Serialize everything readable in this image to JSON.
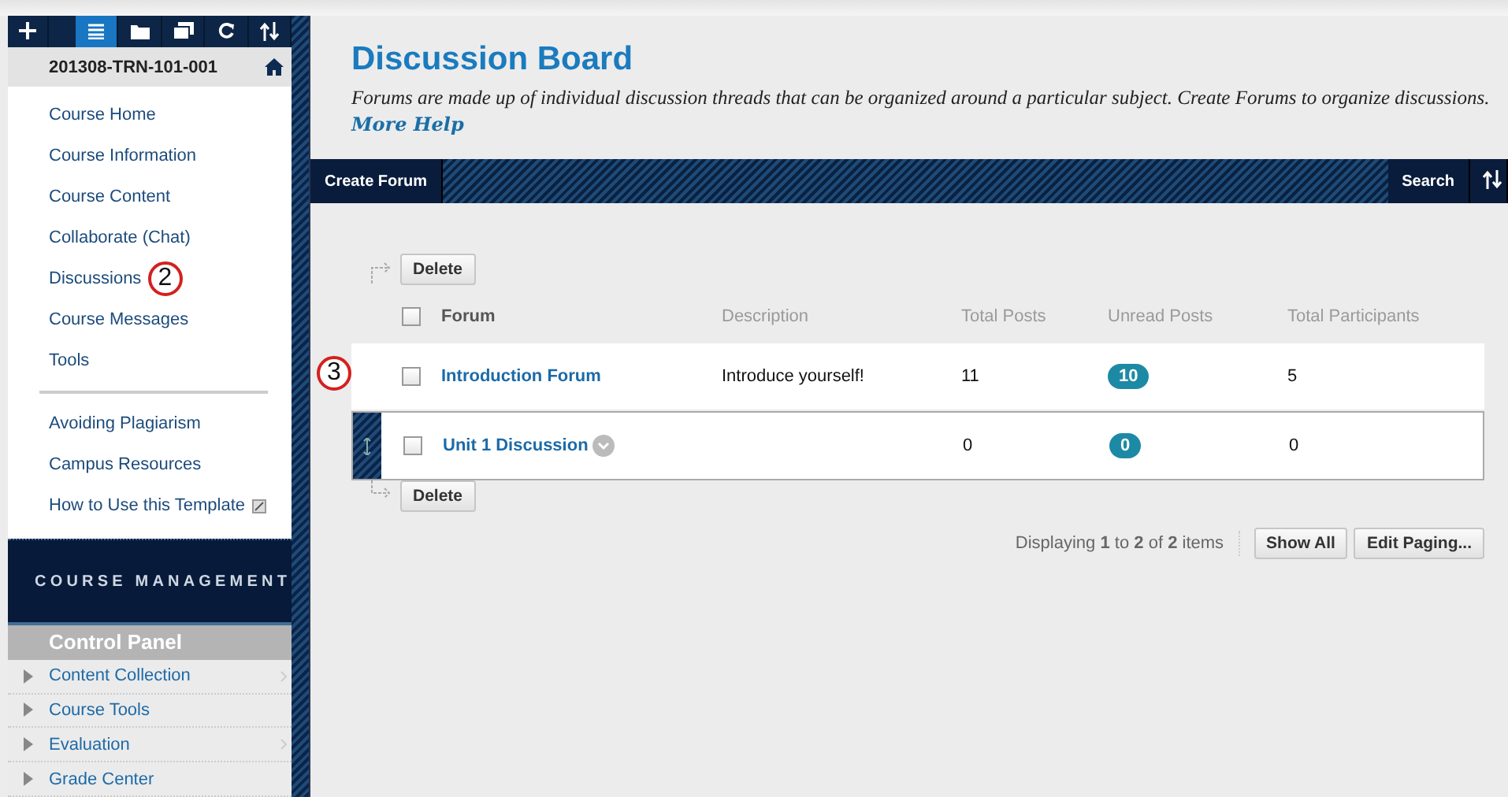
{
  "toolbar": [
    {
      "kind": "add",
      "selected": false
    },
    {
      "kind": "list",
      "selected": true
    },
    {
      "kind": "folder",
      "selected": false
    },
    {
      "kind": "window",
      "selected": false
    },
    {
      "kind": "refresh",
      "selected": false
    },
    {
      "kind": "sort",
      "selected": false
    }
  ],
  "course": {
    "title": "201308-TRN-101-001"
  },
  "menu": [
    {
      "label": "Course Home"
    },
    {
      "label": "Course Information"
    },
    {
      "label": "Course Content"
    },
    {
      "label": "Collaborate (Chat)"
    },
    {
      "label": "Discussions",
      "callout": "2"
    },
    {
      "label": "Course Messages"
    },
    {
      "label": "Tools"
    }
  ],
  "links": [
    {
      "label": "Avoiding Plagiarism",
      "external": false
    },
    {
      "label": "Campus Resources",
      "external": false
    },
    {
      "label": "How to Use this Template",
      "external": true
    }
  ],
  "management": {
    "heading": "COURSE MANAGEMENT",
    "panel": "Control Panel",
    "items": [
      {
        "label": "Content Collection",
        "chevron": true
      },
      {
        "label": "Course Tools",
        "chevron": false
      },
      {
        "label": "Evaluation",
        "chevron": true
      },
      {
        "label": "Grade Center",
        "chevron": false
      }
    ]
  },
  "page": {
    "title": "Discussion Board",
    "description": "Forums are made up of individual discussion threads that can be organized around a particular subject. Create Forums to organize discussions.",
    "help": "More Help"
  },
  "action_bar": {
    "create": "Create Forum",
    "search": "Search"
  },
  "delete_top": "Delete",
  "delete_bottom": "Delete",
  "table": {
    "columns": [
      "Forum",
      "Description",
      "Total Posts",
      "Unread Posts",
      "Total Participants"
    ],
    "select_all_checked": false,
    "rows": [
      {
        "forum": "Introduction Forum",
        "description": "Introduce yourself!",
        "total_posts": "11",
        "unread": "10",
        "participants": "5",
        "checked": false,
        "callout": "3",
        "highlighted": false
      },
      {
        "forum": "Unit 1 Discussion",
        "total_posts": "0",
        "unread": "0",
        "participants": "0",
        "checked": false,
        "highlighted": true
      }
    ]
  },
  "paging": {
    "text": "Displaying **1** to **2** of **2** items",
    "show_all": "Show All",
    "edit": "Edit Paging..."
  }
}
